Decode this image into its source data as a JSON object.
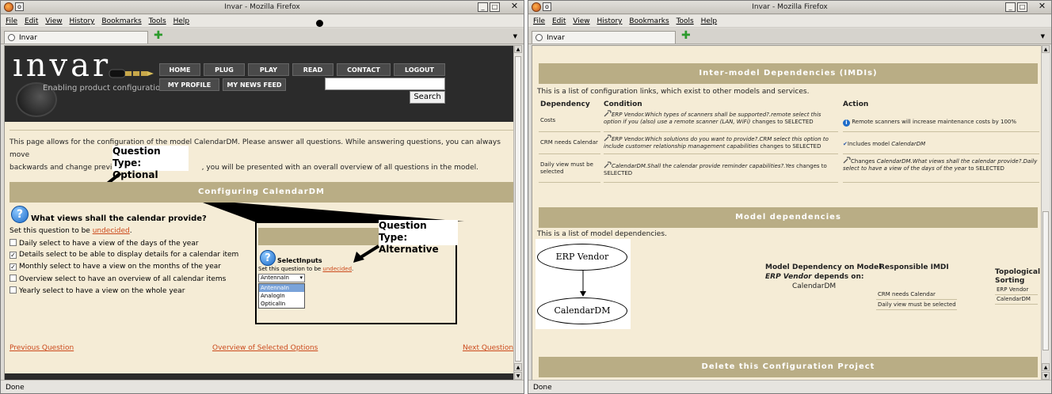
{
  "left_window": {
    "title": "Invar - Mozilla Firefox",
    "menu": [
      "File",
      "Edit",
      "View",
      "History",
      "Bookmarks",
      "Tools",
      "Help"
    ],
    "tab_label": "Invar",
    "status": "Done",
    "site": {
      "logo": "ınvar",
      "tagline": "Enabling product configuration",
      "nav_row1": [
        "HOME",
        "PLUG",
        "PLAY",
        "READ",
        "CONTACT",
        "LOGOUT"
      ],
      "nav_row2": [
        "MY PROFILE",
        "MY NEWS FEED"
      ],
      "search_button": "Search"
    },
    "intro": "This page allows for the configuration of the model CalendarDM. Please answer all questions. While answering questions, you can always move backwards and change previous answers. Finally, you will be presented with an overall overview of all questions in the model.",
    "intro_parts": {
      "a": "This page allows for the configuration of the model CalendarDM. Please answer all questions. While answering questions, you can always move",
      "b": "backwards and change previou",
      "c": ", you will be presented with an overall overview of all questions in the model."
    },
    "section_title": "Configuring CalendarDM",
    "question": {
      "icon": "question-icon",
      "title": "What views shall the calendar provide?",
      "set_prefix": "Set this question to be ",
      "set_link": "undecided",
      "set_suffix": ".",
      "options": [
        {
          "label": "Daily select to have a view of the days of the year",
          "checked": false
        },
        {
          "label": "Details select to be able to display details for a calendar item",
          "checked": true
        },
        {
          "label": "Monthly select to have a view on the months of the year",
          "checked": true
        },
        {
          "label": "Overview select to have an overview of all calendar items",
          "checked": false
        },
        {
          "label": "Yearly select to have a view on the whole year",
          "checked": false
        }
      ]
    },
    "annotation_optional": {
      "line1": "Question Type:",
      "line2": "Optional"
    },
    "annotation_alternative": {
      "line1": "Question Type:",
      "line2": "Alternative"
    },
    "popup": {
      "title": "SelectInputs",
      "set_prefix": "Set this question to be ",
      "set_link": "undecided",
      "set_suffix": ".",
      "selected": "AntennaIn",
      "options": [
        "AntennaIn",
        "AnalogIn",
        "OpticalIn"
      ]
    },
    "bottom_nav": {
      "prev": "Previous Question",
      "overview": "Overview of Selected Options",
      "next": "Next Question"
    }
  },
  "right_window": {
    "title": "Invar - Mozilla Firefox",
    "menu": [
      "File",
      "Edit",
      "View",
      "History",
      "Bookmarks",
      "Tools",
      "Help"
    ],
    "tab_label": "Invar",
    "status": "Done",
    "imdi_title": "Inter-model Dependencies (IMDIs)",
    "imdi_intro": "This is a list of configuration links, which exist to other models and services.",
    "imdi_headers": [
      "Dependency",
      "Condition",
      "Action"
    ],
    "imdi_rows": [
      {
        "dependency": "Costs",
        "condition_italic": "ERP Vendor.Which types of scanners shall be supported?.remote select this option if you (also) use a remote scanner (LAN, WiFi)",
        "condition_tail": " changes to SELECTED",
        "action": "Remote scanners will increase maintenance costs by 100%"
      },
      {
        "dependency": "CRM needs Calendar",
        "condition_italic": "ERP Vendor.Which solutions do you want to provide?.CRM select this option to include customer relationship management capabilities",
        "condition_tail": " changes to SELECTED",
        "action_prefix": "Includes model ",
        "action_italic": "CalendarDM"
      },
      {
        "dependency": "Daily view must be selected",
        "condition_italic": "CalendarDM.Shall the calendar provide reminder capabilities?.Yes",
        "condition_tail": " changes to SELECTED",
        "action_prefix": "Changes ",
        "action_italic": "CalendarDM.What views shall the calendar provide?.Daily select to have a view of the days of the year",
        "action_tail": " to SELECTED"
      }
    ],
    "model_title": "Model dependencies",
    "model_intro": "This is a list of model dependencies.",
    "graph_nodes": [
      "ERP Vendor",
      "CalendarDM"
    ],
    "model_headers": {
      "model": "Model",
      "dep_on": "Dependency on Model",
      "resp": "Responsible IMDI",
      "topo1": "Topological",
      "topo2": "Sorting"
    },
    "model_row": {
      "depends_italic": "ERP Vendor",
      "depends_text": " depends on:",
      "dep_model": "CalendarDM",
      "imdis": [
        "CRM needs Calendar",
        "Daily view must be selected"
      ],
      "sorting": [
        "ERP Vendor",
        "CalendarDM"
      ]
    },
    "delete_title": "Delete this Configuration Project"
  }
}
